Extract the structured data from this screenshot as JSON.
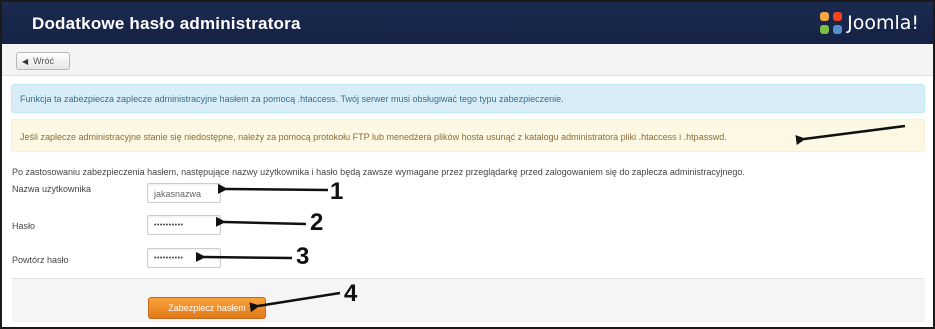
{
  "header": {
    "title": "Dodatkowe hasło administratora",
    "logo_text": "Joomla!"
  },
  "toolbar": {
    "back_label": "Wróć",
    "back_icon": "arrow-left-icon"
  },
  "alerts": {
    "info": "Funkcja ta zabezpiecza zaplecze administracyjne hasłem za pomocą .htaccess. Twój serwer musi obsługiwać tego typu zabezpieczenie.",
    "warning": "Jeśli zaplecze administracyjne stanie się niedostępne, należy za pomocą protokołu FTP lub menedżera plików hosta usunąć z katalogu administratora pliki .htaccess i .htpasswd."
  },
  "form": {
    "intro": "Po zastosowaniu zabezpieczenia hasłem, następujące nazwy użytkownika i hasło będą zawsze wymagane przez przeglądarkę przed zalogowaniem się do zaplecza administracyjnego.",
    "username_label": "Nazwa użytkownika",
    "username_value": "jakasnazwa",
    "password_label": "Hasło",
    "password_value": "••••••••••",
    "repeat_label": "Powtórz hasło",
    "repeat_value": "••••••••••",
    "submit_label": "Zabezpiecz hasłem"
  },
  "annotations": {
    "n1": "1",
    "n2": "2",
    "n3": "3",
    "n4": "4"
  },
  "colors": {
    "header_bg": "#1c2a4f",
    "info_bg": "#d9edf7",
    "warning_bg": "#fcf8e3",
    "button_orange": "#f39c2c"
  }
}
